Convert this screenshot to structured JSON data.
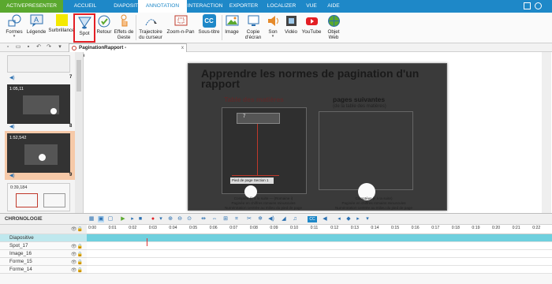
{
  "menubar": {
    "app": "ACTIVEPRESENTER",
    "tabs": [
      "ACCUEIL",
      "DIAPOSITIVE",
      "ANNOTATION",
      "INTERACTION",
      "EXPORTER",
      "LOCALIZER",
      "VUE",
      "AIDE"
    ],
    "active_tab": "ANNOTATION"
  },
  "ribbon": {
    "formes": "Formes",
    "legende": "Légende",
    "surbrillance": "Surbrillance",
    "spot": "Spot",
    "retour": "Retour",
    "effets1": "Effets de",
    "effets2": "Geste",
    "traj1": "Trajectoire",
    "traj2": "du curseur",
    "zoom": "Zoom-n-Pan",
    "soustitre": "Sous-titre",
    "image": "Image",
    "copie1": "Copie",
    "copie2": "d'écran",
    "son": "Son",
    "video": "Vidéo",
    "youtube": "YouTube",
    "web1": "Objet",
    "web2": "Web",
    "cc": "CC"
  },
  "document": {
    "tab_label": "PaginationRapport - PaginationRapport.approj",
    "close": "x"
  },
  "slides": [
    {
      "number": "7",
      "timestamp": ""
    },
    {
      "number": "8",
      "timestamp": "1:05,11"
    },
    {
      "number": "9",
      "timestamp": "1:52,542"
    },
    {
      "number": "10",
      "timestamp": "0:39,184"
    }
  ],
  "stage": {
    "title": "Apprendre les normes de pagination d'un rapport",
    "left_heading": "Table des matières",
    "right_heading": "pages suivantes",
    "right_sub": "(de la table des matières)",
    "left_caption": "Comptée (i) à la suite — (Romaine i)\nPaginée en chiffres romains minuscules\nNumérotation centrée au milieu du pied de page",
    "right_caption": "Comptées (ii à la suite)\nPaginée en chiffres romains minuscules\nNumérotation centrée au milieu du pied de page",
    "footer_text": "Pied de page  Section 1",
    "page_number": "7"
  },
  "timeline": {
    "title": "CHRONOLOGIE",
    "ticks": [
      "0:00",
      "0:01",
      "0:02",
      "0:03",
      "0:04",
      "0:05",
      "0:06",
      "0:07",
      "0:08",
      "0:09",
      "0:10",
      "0:11",
      "0:12",
      "0:13",
      "0:14",
      "0:15",
      "0:16",
      "0:17",
      "0:18",
      "0:19",
      "0:20",
      "0:21",
      "0:22"
    ],
    "tracks": [
      "Diapositive",
      "Spot_17",
      "Image_16",
      "Forme_15",
      "Forme_14"
    ]
  },
  "colors": {
    "menubar": "#1e88c8",
    "app_tab": "#5aa82e",
    "selected_outline": "#e31e24",
    "slide_selected": "#f6c9a8",
    "diapositive_track": "#6fd0de"
  }
}
